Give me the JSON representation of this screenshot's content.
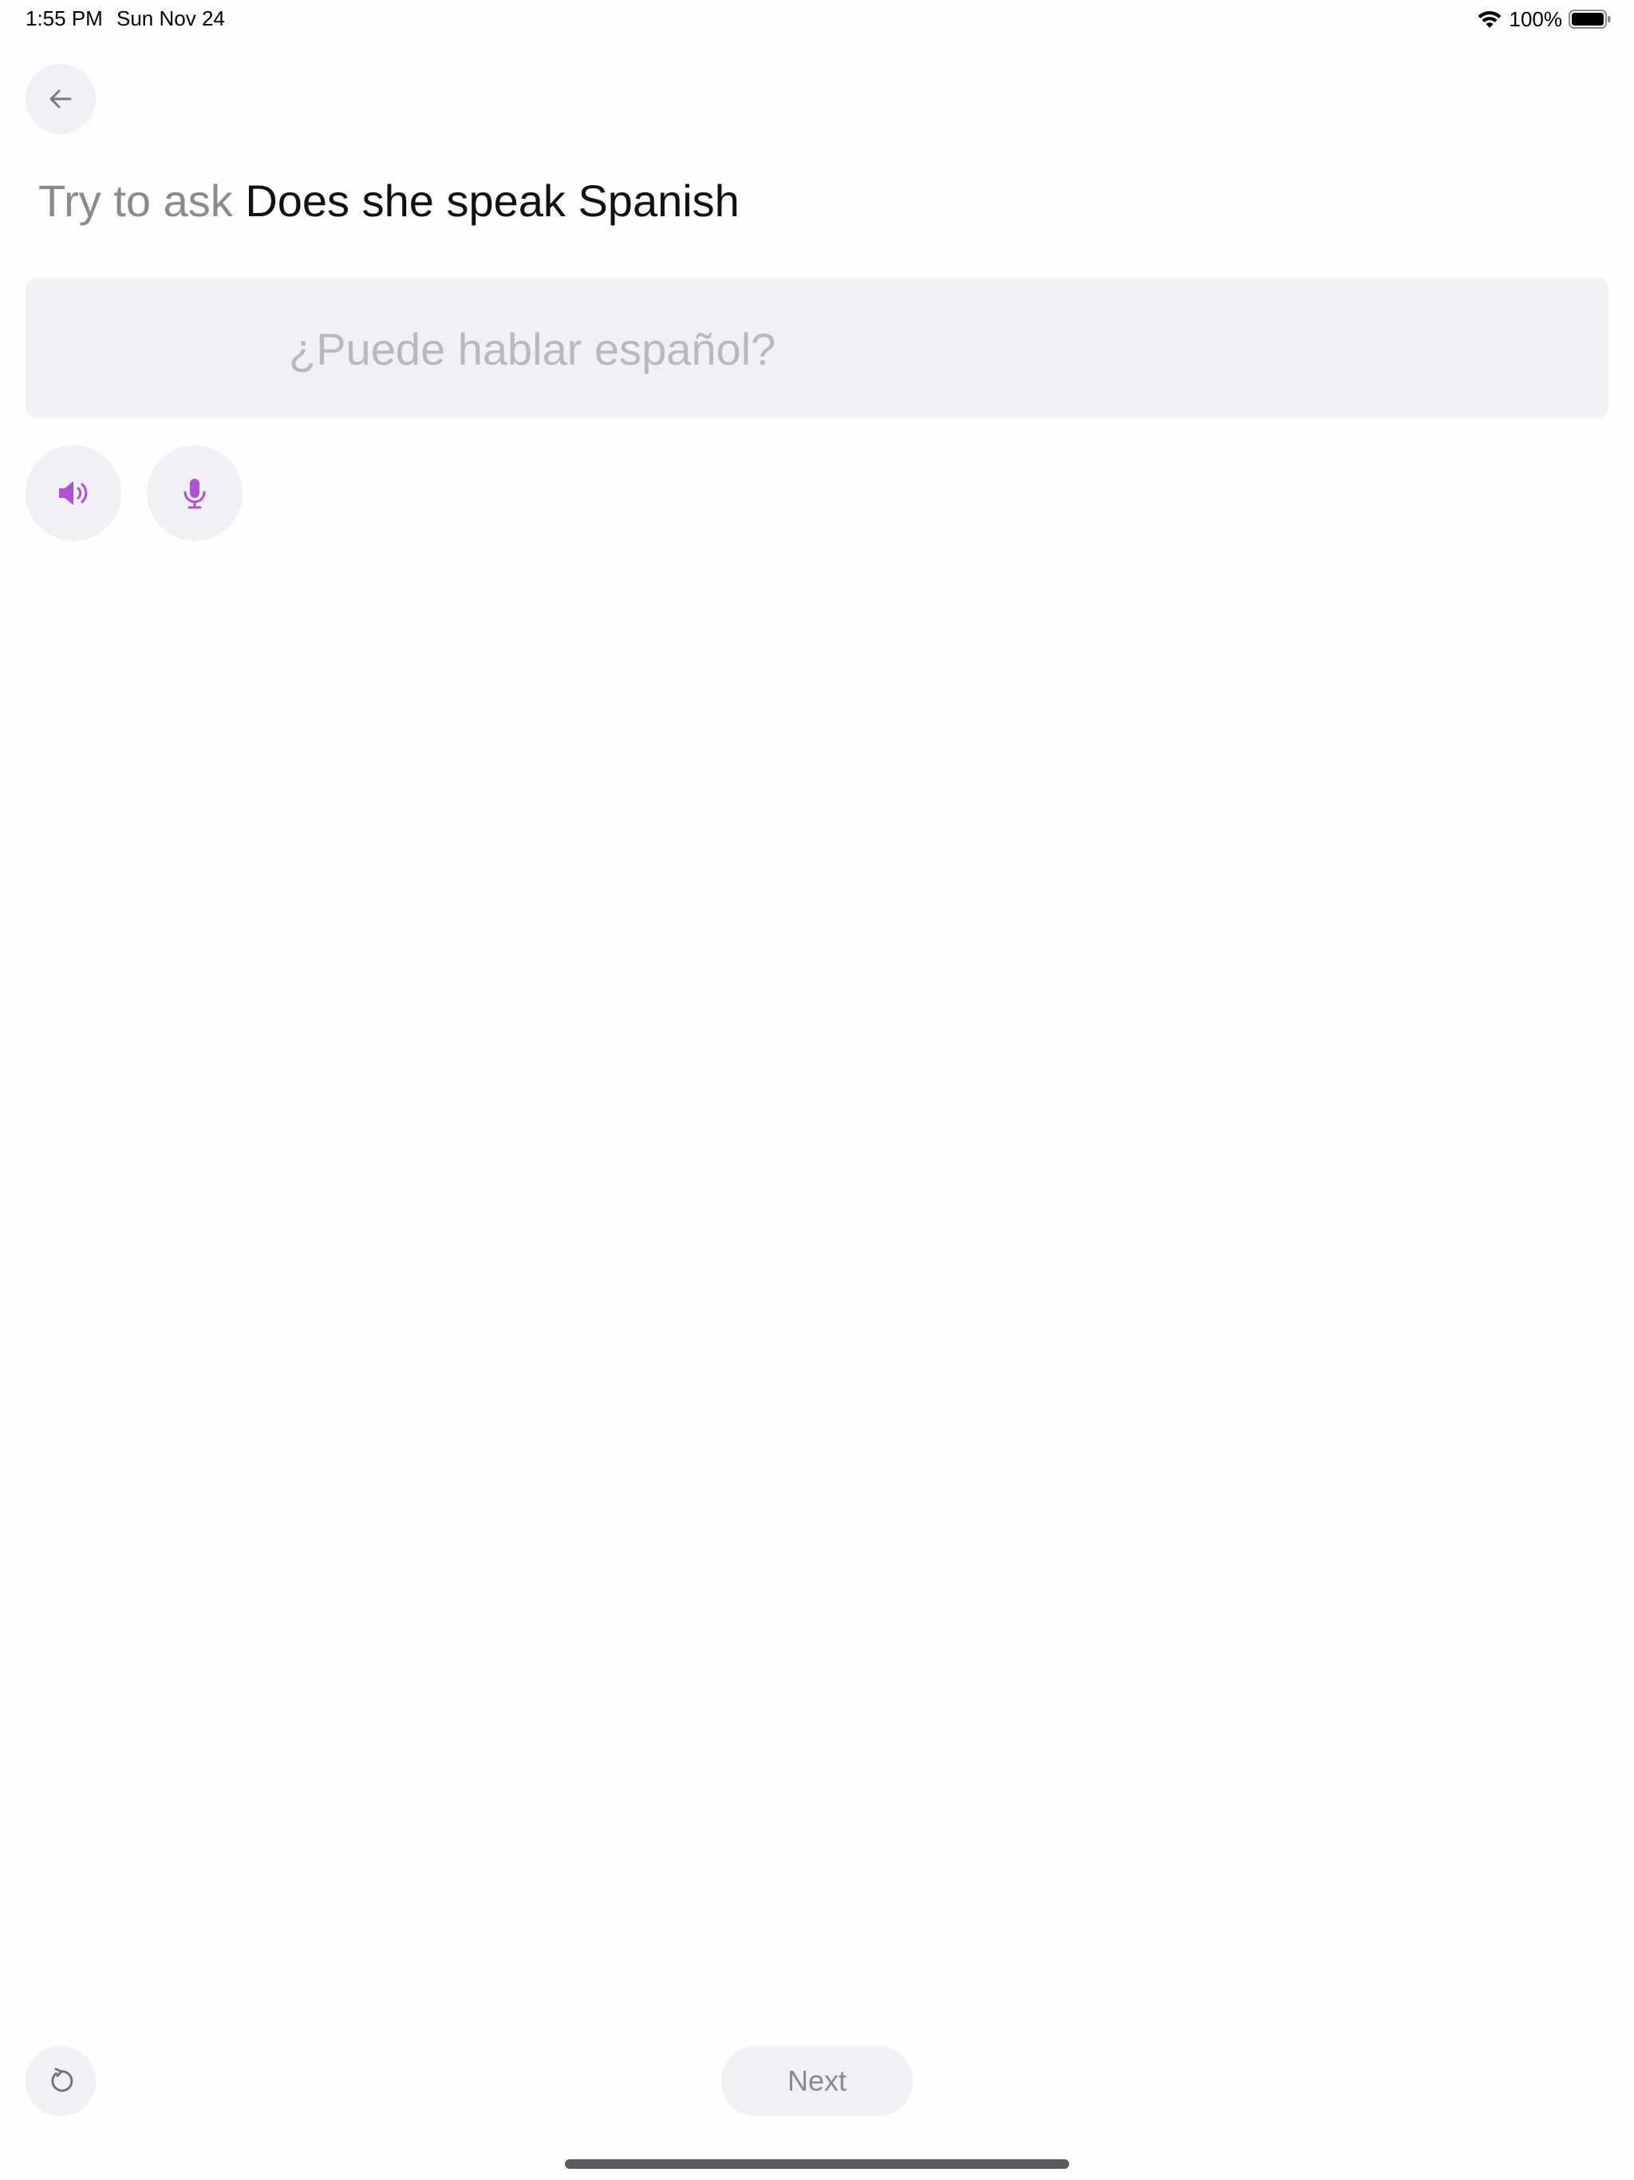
{
  "status_bar": {
    "time": "1:55 PM",
    "date": "Sun Nov 24",
    "battery_percent": "100%",
    "wifi_icon": "wifi-icon",
    "battery_icon": "battery-icon"
  },
  "header": {
    "back_icon": "arrow-left-icon"
  },
  "prompt": {
    "prefix": "Try to ask",
    "phrase": "Does she speak Spanish"
  },
  "answer": {
    "placeholder": "¿Puede hablar español?"
  },
  "actions": {
    "speaker_icon": "speaker-icon",
    "mic_icon": "microphone-icon"
  },
  "footer": {
    "restart_icon": "restart-icon",
    "next_label": "Next"
  },
  "colors": {
    "accent": "#b04fd8",
    "button_bg": "#f1f0f5",
    "muted_text": "#8a8a8e",
    "placeholder_text": "#b9b8be"
  }
}
